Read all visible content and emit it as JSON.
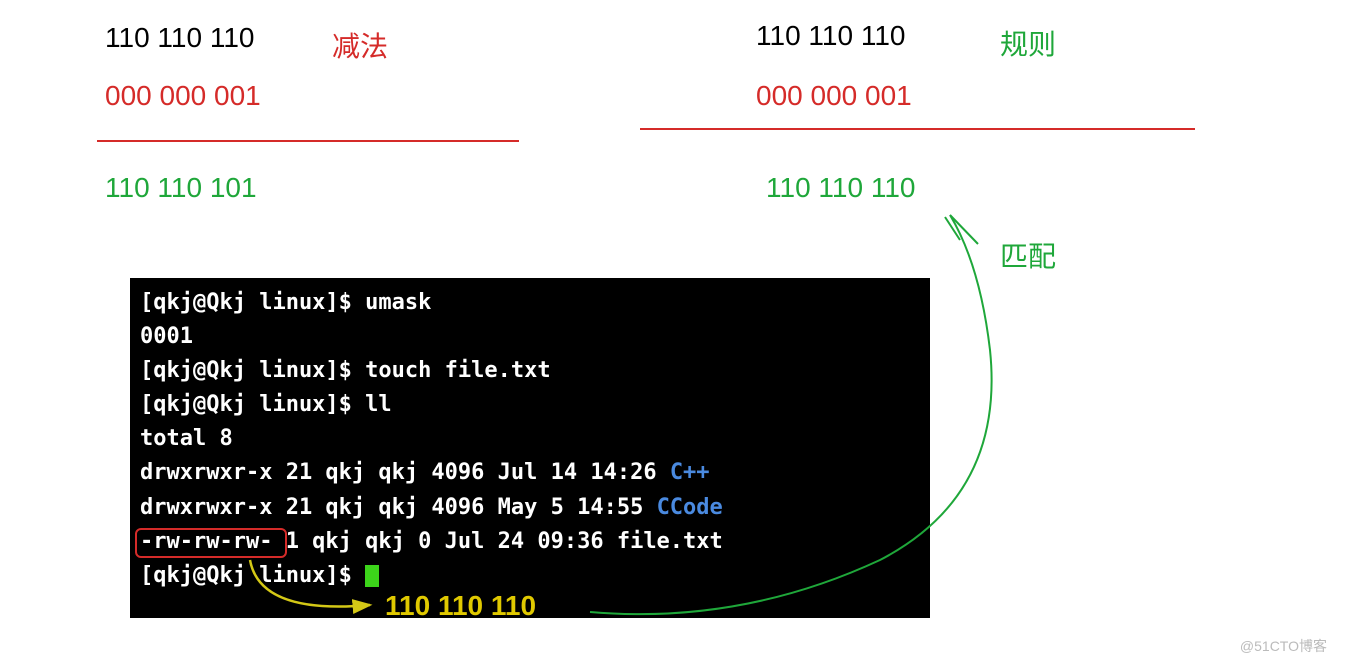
{
  "left": {
    "line1": "110 110 110",
    "line2": "000 000 001",
    "result": "110 110 101",
    "label": "减法"
  },
  "right": {
    "line1": "110 110 110",
    "line2": "000 000 001",
    "result": "110 110 110",
    "label": "规则",
    "match_label": "匹配"
  },
  "terminal": {
    "prompt1": "[qkj@Qkj linux]$ ",
    "cmd1": "umask",
    "out1": "0001",
    "prompt2": "[qkj@Qkj linux]$ ",
    "cmd2": "touch file.txt",
    "prompt3": "[qkj@Qkj linux]$ ",
    "cmd3": "ll",
    "out2": "total 8",
    "row1_perm": "drwxrwxr-x 21 qkj qkj 4096 Jul 14 14:26 ",
    "row1_name": "C++",
    "row2_perm": "drwxrwxr-x 21 qkj qkj 4096 May  5 14:55 ",
    "row2_name": "CCode",
    "row3": "-rw-rw-rw-  1 qkj qkj    0 Jul 24 09:36 file.txt",
    "prompt4": "[qkj@Qkj linux]$ "
  },
  "bottom_bits": "110 110 110",
  "watermark": "@51CTO博客"
}
